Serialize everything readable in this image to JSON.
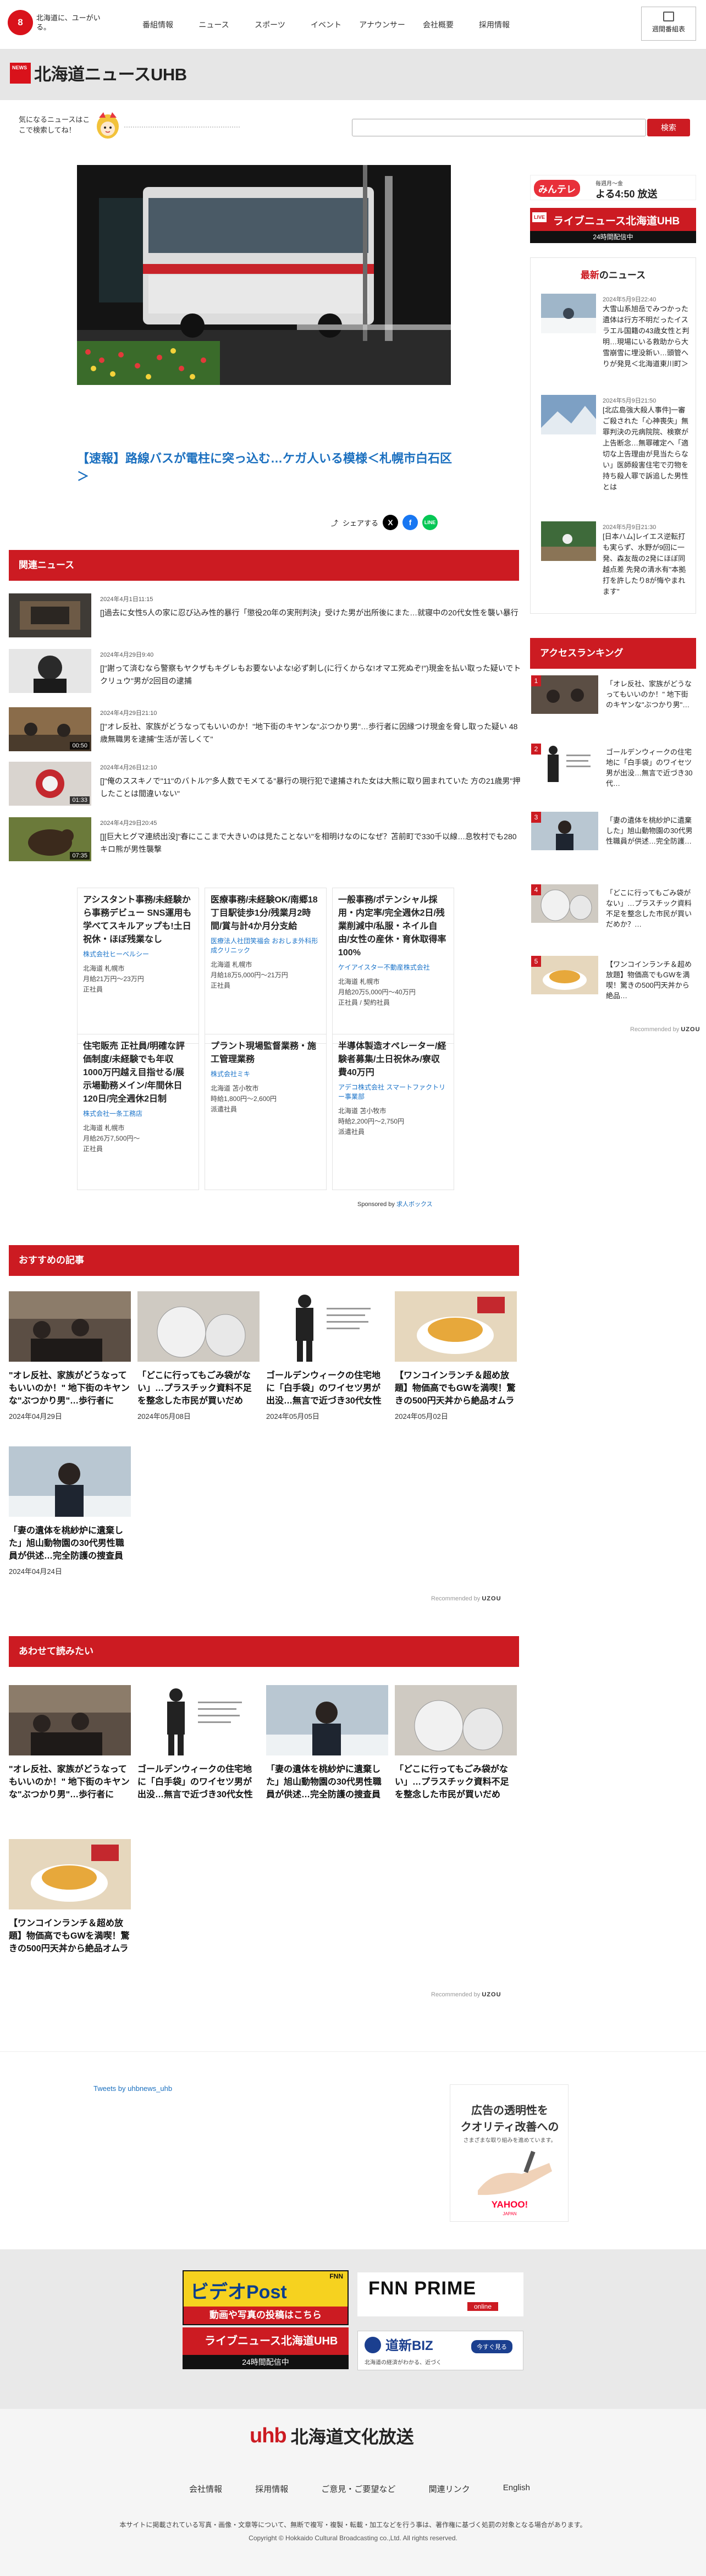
{
  "header": {
    "logo_text": "8",
    "tagline": "北海道に、ユーがいる。",
    "nav": [
      "番組情報",
      "ニュース",
      "スポーツ",
      "イベント",
      "アナウンサー",
      "会社概要",
      "採用情報"
    ],
    "weekly_button": "週間番組表"
  },
  "site": {
    "badge": "NEWS",
    "title": "北海道ニュースUHB"
  },
  "search": {
    "prompt": "気になるニュースはここで検索してね！",
    "placeholder": "",
    "button": "検索"
  },
  "hero": {
    "title": "【速報】路線バスが電柱に突っ込む…ケガ人いる模様＜札幌市白石区＞",
    "share_label": "シェアする"
  },
  "related": {
    "heading": "関連ニュース",
    "items": [
      {
        "date": "2024年4月1日11:15",
        "title": "[]過去に女性5人の家に忍び込み性的暴行「懲役20年の実刑判決」受けた男が出所後にまた…就寝中の20代女性を襲い暴行",
        "duration": ""
      },
      {
        "date": "2024年4月29日9:40",
        "title": "[]\"謝って済むなら警察もヤクザもキグレもお要ないよな!必ず刺し(に行くからな!オマエ死ぬぞ!\")現金を払い取った疑いでトクリュウ\"男が2回目の逮捕",
        "duration": ""
      },
      {
        "date": "2024年4月29日21:10",
        "title": "[]\"オレ反社、家族がどうなってもいいのか！\"地下街のキヤンな\"ぶつかり男\"…歩行者に因縁つけ現金を脅し取った疑い 48歳無職男を逮捕\"生活が苦しくて\"",
        "duration": "00:50"
      },
      {
        "date": "2024年4月26日12:10",
        "title": "[]\"俺のススキノで\"11\"のバトル?\"多人数でモメてる\"暴行の現行犯で逮捕された女は大熊に取り囲まれていた 方の21歳男\"押したことは間違いない\"",
        "duration": "01:33"
      },
      {
        "date": "2024年4月29日20:45",
        "title": "[][巨大ヒグマ連続出没]\"春にここまで大きいのは見たことない\"を相明けなのになぜ？苫前町で330千以線…息牧村でも280キロ熊が男性襲撃",
        "duration": "07:35"
      }
    ]
  },
  "jobs": {
    "items": [
      {
        "title": "アシスタント事務/未経験から事務デビュー SNS運用も学べてスキルアップも!土日祝休・ほぼ残業なし",
        "company": "株式会社ヒーベルシー",
        "location": "北海道 札幌市",
        "pay": "月給21万円〜23万円",
        "type": "正社員"
      },
      {
        "title": "医療事務/未経験OK/南郷18丁目駅徒歩1分/残業月2時間/賞与計4か月分支給",
        "company": "医療法人社団笑福会 おおしま外科形成クリニック",
        "location": "北海道 札幌市",
        "pay": "月給18万5,000円〜21万円",
        "type": "正社員"
      },
      {
        "title": "一般事務/ポテンシャル採用・内定率/完全週休2日/残業削減中/私服・ネイル自由/女性の産休・育休取得率100%",
        "company": "ケイアイスター不動産株式会社",
        "location": "北海道 札幌市",
        "pay": "月給20万5,000円〜40万円",
        "type": "正社員 / 契約社員"
      },
      {
        "title": "住宅販売 正社員/明確な評価制度/未経験でも年収1000万円越え目指せる/展示場勤務メイン/年間休日120日/完全週休2日制",
        "company": "株式会社一条工務店",
        "location": "北海道 札幌市",
        "pay": "月給26万7,500円〜",
        "type": "正社員"
      },
      {
        "title": "プラント現場監督業務・施工管理業務",
        "company": "株式会社ミキ",
        "location": "北海道 苫小牧市",
        "pay": "時給1,800円〜2,600円",
        "type": "派遣社員"
      },
      {
        "title": "半導体製造オペレーター/経験者募集/土日祝休み/寮収費40万円",
        "company": "アデコ株式会社 スマートファクトリー事業部",
        "location": "北海道 苫小牧市",
        "pay": "時給2,200円〜2,750円",
        "type": "派遣社員"
      }
    ],
    "sponsored_label": "Sponsored by",
    "sponsored_brand": "求人ボックス"
  },
  "recommended": {
    "heading": "おすすめの記事",
    "items": [
      {
        "title": "\"オレ反社、家族がどうなってもいいのか！\" 地下街のキヤンな\"ぶつかり男\"…歩行者に因…",
        "date": "2024年04月29日"
      },
      {
        "title": "「どこに行ってもごみ袋がない」…プラスチック資料不足を整念した市民が買いだめか？\"指定…",
        "date": "2024年05月08日"
      },
      {
        "title": "ゴールデンウィークの住宅地に「白手袋」のワイセツ男が出没…無言で近づき30代女性の下…",
        "date": "2024年05月05日"
      },
      {
        "title": "【ワンコインランチ＆超め放題】物価高でもGWを満喫！驚きの500円天丼から絶品オムライ…",
        "date": "2024年05月02日"
      },
      {
        "title": "「妻の遺体を桃紗炉に遺棄した」旭山動物園の30代男性職員が供述…完全防護の捜査員が動組…",
        "date": "2024年04月24日"
      }
    ],
    "recommended_by": "Recommended by",
    "recommended_brand": "UZOU"
  },
  "also_read": {
    "heading": "あわせて読みたい",
    "items": [
      {
        "title": "\"オレ反社、家族がどうなってもいいのか！\" 地下街のキヤンな\"ぶつかり男\"…歩行者に因…"
      },
      {
        "title": "ゴールデンウィークの住宅地に「白手袋」のワイセツ男が出没…無言で近づき30代女性の下…"
      },
      {
        "title": "「妻の遺体を桃紗炉に遺棄した」旭山動物園の30代男性職員が供述…完全防護の捜査員が動組…"
      },
      {
        "title": "「どこに行ってもごみ袋がない」…プラスチック資料不足を整念した市民が買いだめか？\"指定…"
      },
      {
        "title": "【ワンコインランチ＆超め放題】物価高でもGWを満喫！驚きの500円天丼から絶品オムライ…"
      }
    ],
    "recommended_by": "Recommended by",
    "recommended_brand": "UZOU"
  },
  "sidebar": {
    "minna_banner": {
      "logo": "みんテレ",
      "sub": "毎週月〜金",
      "time": "よる4:50 放送"
    },
    "live_banner": {
      "badge": "LIVE",
      "text": "ライブニュース北海道UHB",
      "sub": "24時間配信中"
    },
    "latest": {
      "heading_prefix": "最新",
      "heading_suffix": "のニュース",
      "items": [
        {
          "date": "2024年5月9日22:40",
          "title": "大雪山系旭岳でみつかった遺体は行方不明だったイスラエル国籍の43歳女性と判明…現場にいる救助から大雪崩雪に埋没新い…頭管へりが発見＜北海道東川町＞"
        },
        {
          "date": "2024年5月9日21:50",
          "title": "[北広島強大殺人事件]一審ご殺された「心神喪失」無罪判決の元病院院、検察が上告断念…無罪確定へ「適切な上告理由が見当たらない」医師殺害住宅で刃物を持ち殺人罪で訴追した男性とは"
        },
        {
          "date": "2024年5月9日21:30",
          "title": "[日本ハム]レイエス逆転打も実らず、水野が9回に一発、森友哉の2発にほぼ同越点差 先発の清水有\"本拠打を許したり8が悔やまれます\""
        }
      ]
    },
    "ranking": {
      "heading": "アクセスランキング",
      "items": [
        {
          "rank": "1",
          "title": "「オレ反社、家族がどうなってもいいのか！\" 地下街のキヤンな\"ぶつかり男\"…"
        },
        {
          "rank": "2",
          "title": "ゴールデンウィークの住宅地に「白手袋」のワイセツ男が出没…無言で近づき30代…"
        },
        {
          "rank": "3",
          "title": "「妻の遺体を桃紗炉に遺棄した」旭山動物園の30代男性職員が供述…完全防護…"
        },
        {
          "rank": "4",
          "title": "「どこに行ってもごみ袋がない」…プラスチック資料不足を整念した市民が買いだめか？…"
        },
        {
          "rank": "5",
          "title": "【ワンコインランチ＆超め放題】物価高でもGWを満喫！驚きの500円天丼から絶品…"
        }
      ],
      "recommended_by": "Recommended by",
      "recommended_brand": "UZOU"
    }
  },
  "tweets_link": "Tweets by uhbnews_uhb",
  "ad_yahoo": {
    "line1": "広告の透明性を",
    "line2": "クオリティ改善への",
    "line3": "さまざまな取り組みを進めています。",
    "brand": "YAHOO!",
    "brand_sub": "JAPAN"
  },
  "banners": {
    "videopost": {
      "fnn": "FNN",
      "main": "ビデオPost",
      "sub": "動画や写真の投稿はこちら"
    },
    "fnnprime": {
      "main": "FNN PRIME",
      "sub": "online"
    },
    "live": {
      "text": "ライブニュース北海道UHB",
      "sub": "24時間配信中"
    },
    "biz": {
      "main": "道新BIZ",
      "sub": "北海道の経済がわかる、近づく",
      "btn": "今すぐ見る"
    }
  },
  "footer": {
    "logo": "uhb",
    "name": "北海道文化放送",
    "links": [
      "会社情報",
      "採用情報",
      "ご意見・ご要望など",
      "関連リンク",
      "English"
    ],
    "note": "本サイトに掲載されている写真・画像・文章等について、無断で複写・複製・転載・加工などを行う事は、著作権に基づく処罰の対象となる場合があります。",
    "copyright": "Copyright © Hokkaido Cultural Broadcasting co.,Ltd. All rights reserved."
  },
  "colors": {
    "accent": "#cc1b22",
    "link": "#1a6fbf"
  }
}
